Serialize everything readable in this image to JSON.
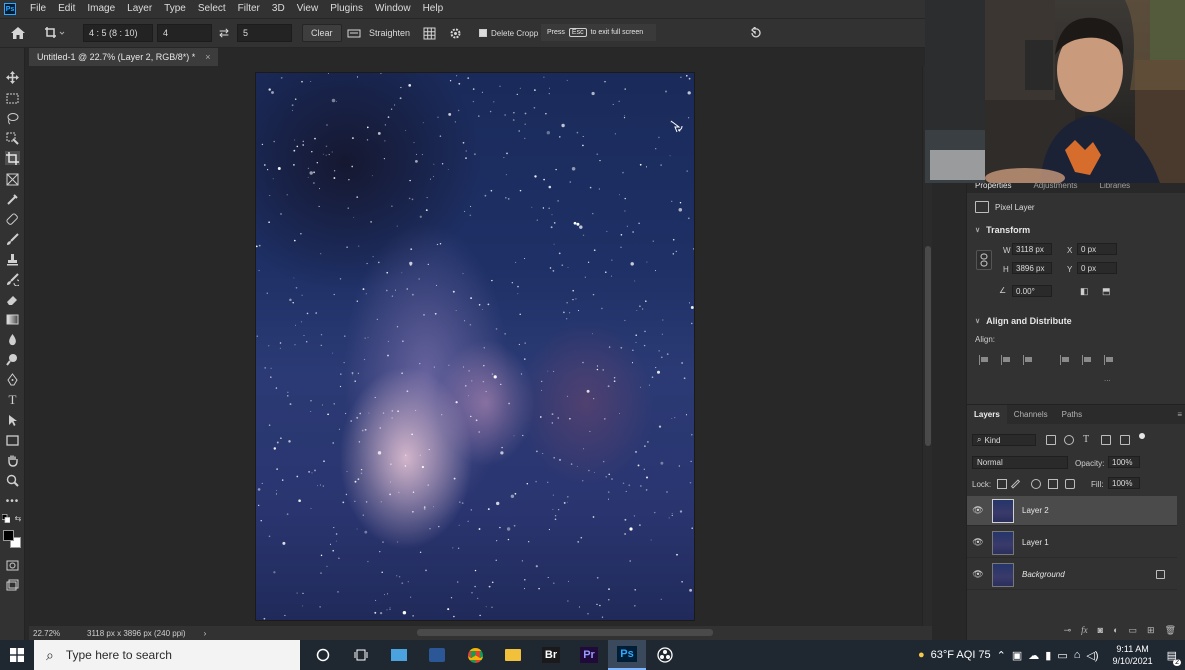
{
  "menu": {
    "app_logo": "Ps",
    "items": [
      "File",
      "Edit",
      "Image",
      "Layer",
      "Type",
      "Select",
      "Filter",
      "3D",
      "View",
      "Plugins",
      "Window",
      "Help"
    ]
  },
  "options_bar": {
    "ratio_preset": "4 : 5 (8 : 10)",
    "width_value": "4",
    "height_value": "5",
    "clear_label": "Clear",
    "straighten_label": "Straighten",
    "delete_cropped_label": "Delete Cropp",
    "fullscreen_hint": {
      "press": "Press",
      "key": "Esc",
      "rest": "to exit full screen"
    }
  },
  "document_tab": {
    "title": "Untitled-1 @ 22.7% (Layer 2, RGB/8*) *",
    "close": "×"
  },
  "status_bar": {
    "zoom": "22.72%",
    "doc_info": "3118 px x 3896 px (240 ppi)",
    "arrow": "›"
  },
  "properties": {
    "tabs": [
      "Properties",
      "Adjustments",
      "Libraries"
    ],
    "layer_type": "Pixel Layer",
    "transform": {
      "heading": "Transform",
      "w_label": "W",
      "w_value": "3118 px",
      "h_label": "H",
      "h_value": "3896 px",
      "x_label": "X",
      "x_value": "0 px",
      "y_label": "Y",
      "y_value": "0 px",
      "angle_value": "0.00°"
    },
    "align": {
      "heading": "Align and Distribute",
      "label": "Align:",
      "more": "..."
    }
  },
  "layers_panel": {
    "tabs": [
      "Layers",
      "Channels",
      "Paths"
    ],
    "kind_label": "Kind",
    "blend_mode": "Normal",
    "opacity_label": "Opacity:",
    "opacity_value": "100%",
    "lock_label": "Lock:",
    "fill_label": "Fill:",
    "fill_value": "100%",
    "layers": [
      {
        "name": "Layer 2",
        "selected": true,
        "italic": false,
        "locked": false
      },
      {
        "name": "Layer 1",
        "selected": false,
        "italic": false,
        "locked": false
      },
      {
        "name": "Background",
        "selected": false,
        "italic": true,
        "locked": true
      }
    ]
  },
  "taskbar": {
    "search_placeholder": "Type here to search",
    "apps": [
      "Br",
      "Pr",
      "Ps"
    ],
    "weather": "63°F  AQI 75",
    "time": "9:11 AM",
    "date": "9/10/2021",
    "notification_count": "2"
  },
  "colors": {
    "accent": "#31a8ff",
    "panel_bg": "#323232",
    "canvas_bg": "#282828",
    "taskbar_bg": "#1f2731"
  }
}
